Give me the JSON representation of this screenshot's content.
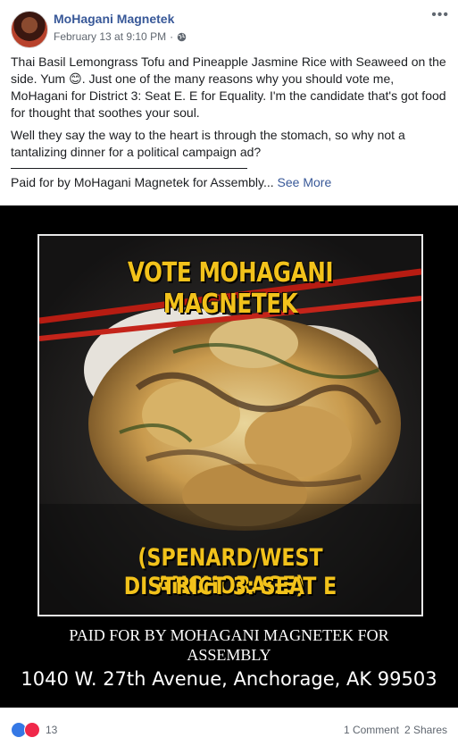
{
  "post": {
    "author": "MoHagani Magnetek",
    "timestamp": "February 13 at 9:10 PM",
    "separator": "·",
    "privacy_icon": "globe-icon",
    "more_icon": "•••"
  },
  "body": {
    "paragraph1": "Thai Basil Lemongrass Tofu and Pineapple Jasmine Rice with Seaweed on the side. Yum 😊. Just one of the many reasons why you should vote me, MoHagani for District 3: Seat E. E for Equality. I'm the candidate that's got food for thought that soothes your soul.",
    "paragraph2": "Well they say the way to the heart is through the stomach, so why not a tantalizing dinner for a political campaign ad?",
    "paid_line": "Paid for by MoHagani Magnetek for Assembly...",
    "see_more": "See More"
  },
  "image": {
    "headline": "VOTE MOHAGANI MAGNETEK",
    "sub1": "(SPENARD/WEST ANCHORAGE)",
    "sub2": "DISTRICT 3: SEAT E",
    "paid_by": "PAID FOR BY MOHAGANI MAGNETEK FOR ASSEMBLY",
    "address": "1040 W. 27th Avenue, Anchorage, AK 99503"
  },
  "footer": {
    "reaction_count": "13",
    "comments": "1 Comment",
    "shares": "2 Shares"
  },
  "colors": {
    "link": "#385898",
    "headline_yellow": "#f2c21b",
    "like_blue": "#3578e5",
    "love_red": "#f0284a"
  }
}
